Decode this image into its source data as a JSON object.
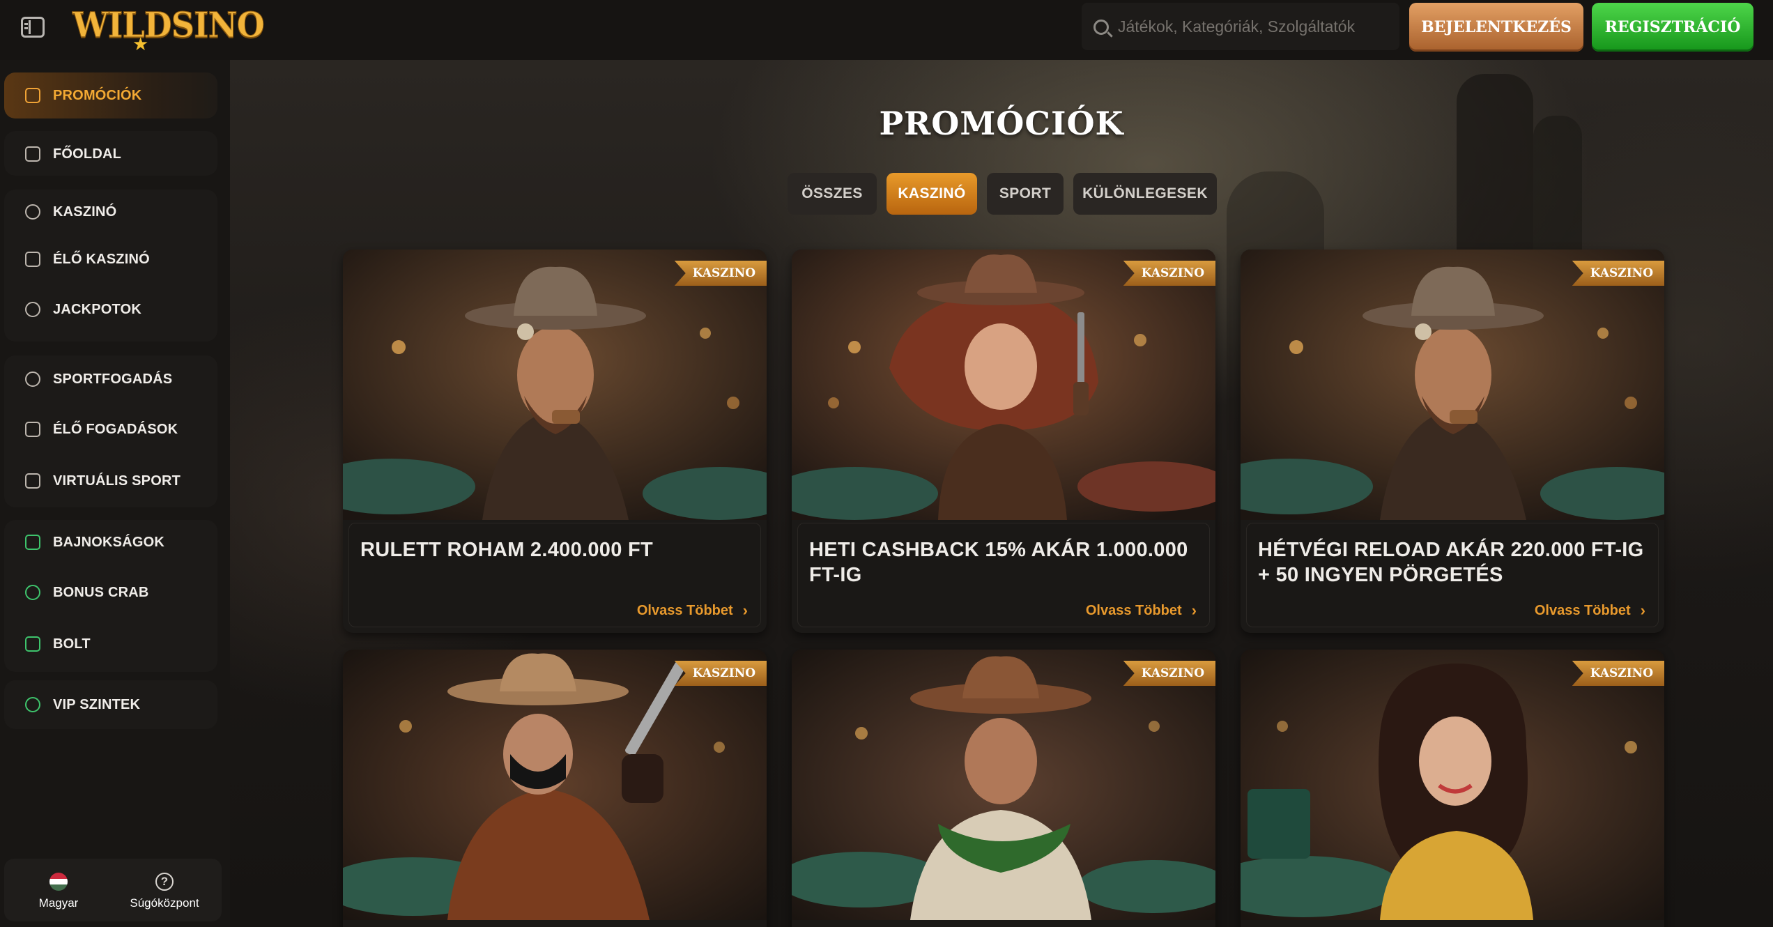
{
  "header": {
    "logo_text": "WILDSINO",
    "search_placeholder": "Játékok, Kategóriák, Szolgáltatók",
    "login_label": "BEJELENTKEZÉS",
    "register_label": "REGISZTRÁCIÓ"
  },
  "sidebar": {
    "items": [
      {
        "label": "PROMÓCIÓK",
        "icon": "gift-icon"
      },
      {
        "label": "FŐOLDAL",
        "icon": "home-icon"
      },
      {
        "label": "KASZINÓ",
        "icon": "chip-icon"
      },
      {
        "label": "ÉLŐ KASZINÓ",
        "icon": "live-casino-icon"
      },
      {
        "label": "JACKPOTOK",
        "icon": "jackpot-icon"
      },
      {
        "label": "SPORTFOGADÁS",
        "icon": "soccer-ball-icon"
      },
      {
        "label": "ÉLŐ FOGADÁSOK",
        "icon": "live-bets-icon"
      },
      {
        "label": "VIRTUÁLIS SPORT",
        "icon": "gamepad-icon"
      },
      {
        "label": "BAJNOKSÁGOK",
        "icon": "trophy-icon"
      },
      {
        "label": "BONUS CRAB",
        "icon": "bonus-crab-icon"
      },
      {
        "label": "BOLT",
        "icon": "shop-icon"
      },
      {
        "label": "VIP SZINTEK",
        "icon": "vip-crown-icon"
      }
    ],
    "footer": {
      "language_label": "Magyar",
      "help_label": "Súgóközpont"
    }
  },
  "main": {
    "title": "PROMÓCIÓK",
    "tabs": [
      {
        "label": "ÖSSZES"
      },
      {
        "label": "KASZINÓ"
      },
      {
        "label": "SPORT"
      },
      {
        "label": "KÜLÖNLEGESEK"
      }
    ],
    "cards": [
      {
        "badge": "KASZINO",
        "title": "RULETT ROHAM 2.400.000 FT",
        "link": "Olvass Többet"
      },
      {
        "badge": "KASZINO",
        "title": "HETI CASHBACK 15% AKÁR 1.000.000 FT-IG",
        "link": "Olvass Többet"
      },
      {
        "badge": "KASZINO",
        "title": "HÉTVÉGI RELOAD AKÁR 220.000 FT-IG + 50 INGYEN PÖRGETÉS",
        "link": "Olvass Többet"
      },
      {
        "badge": "KASZINO"
      },
      {
        "badge": "KASZINO"
      },
      {
        "badge": "KASZINO"
      }
    ]
  },
  "colors": {
    "accent_orange": "#e99a2d",
    "login_button": "#c17a3f",
    "register_button": "#2bb42f",
    "background": "#151312"
  }
}
